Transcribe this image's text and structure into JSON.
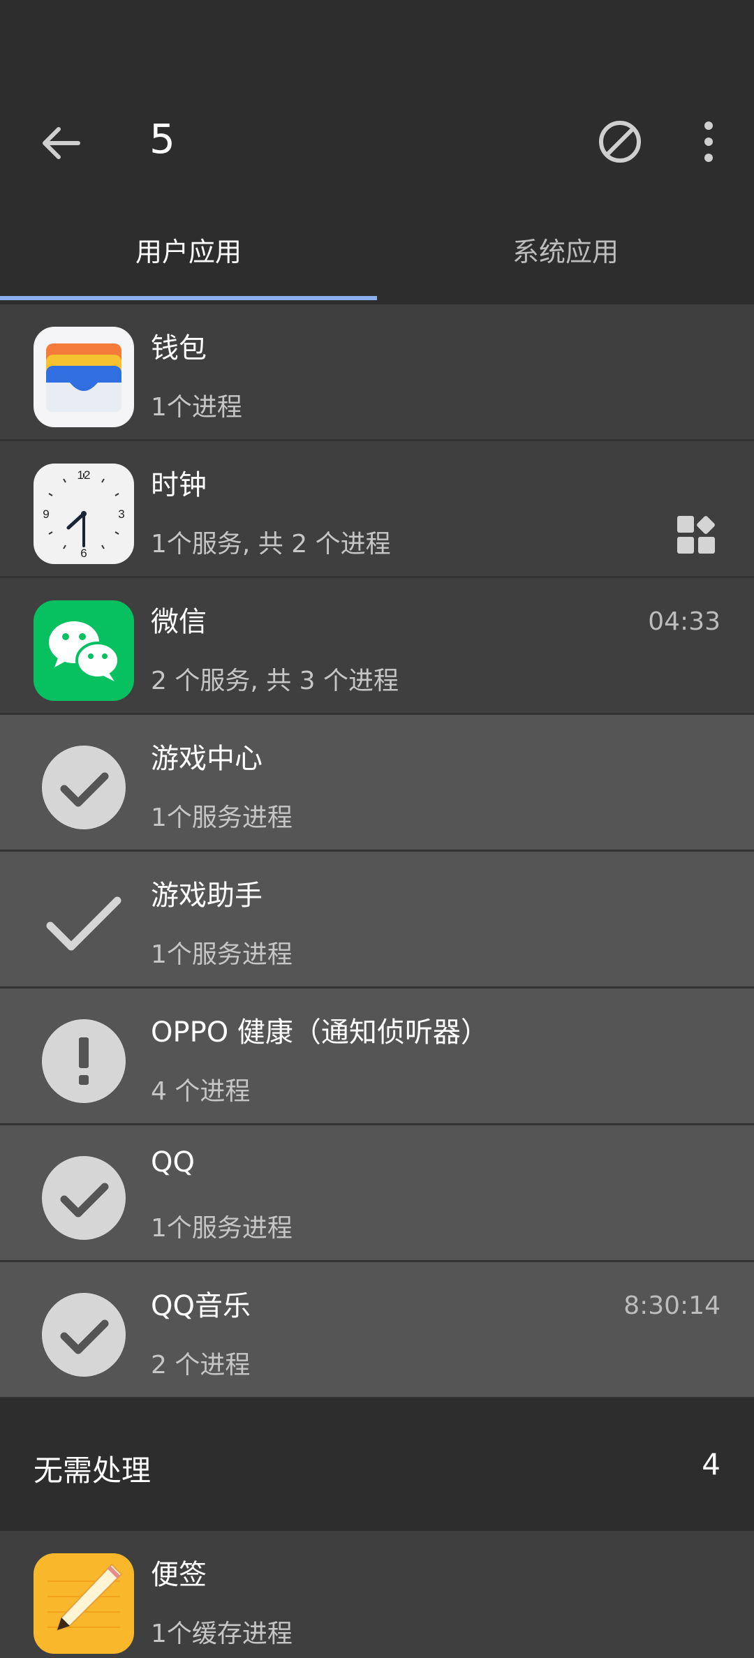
{
  "header": {
    "title": "5"
  },
  "tabs": [
    {
      "label": "用户应用"
    },
    {
      "label": "系统应用"
    }
  ],
  "apps": [
    {
      "name": "钱包",
      "detail": "1个进程",
      "time": ""
    },
    {
      "name": "时钟",
      "detail": "1个服务, 共 2 个进程",
      "time": ""
    },
    {
      "name": "微信",
      "detail": "2 个服务, 共 3 个进程",
      "time": "04:33"
    },
    {
      "name": "游戏中心",
      "detail": "1个服务进程",
      "time": ""
    },
    {
      "name": "游戏助手",
      "detail": "1个服务进程",
      "time": ""
    },
    {
      "name": "OPPO 健康（通知侦听器）",
      "detail": "4 个进程",
      "time": ""
    },
    {
      "name": "QQ",
      "detail": "1个服务进程",
      "time": ""
    },
    {
      "name": "QQ音乐",
      "detail": "2 个进程",
      "time": "8:30:14"
    }
  ],
  "clock_face": [
    "12",
    "3",
    "6",
    "9"
  ],
  "section": {
    "label": "无需处理",
    "count": "4"
  },
  "bottom_app": {
    "name": "便签",
    "detail": "1个缓存进程"
  },
  "colors": {
    "accent": "#8ab0ee",
    "background": "#2d2d2d",
    "row_dark": "#3f3f3f",
    "row_light": "#555555"
  }
}
